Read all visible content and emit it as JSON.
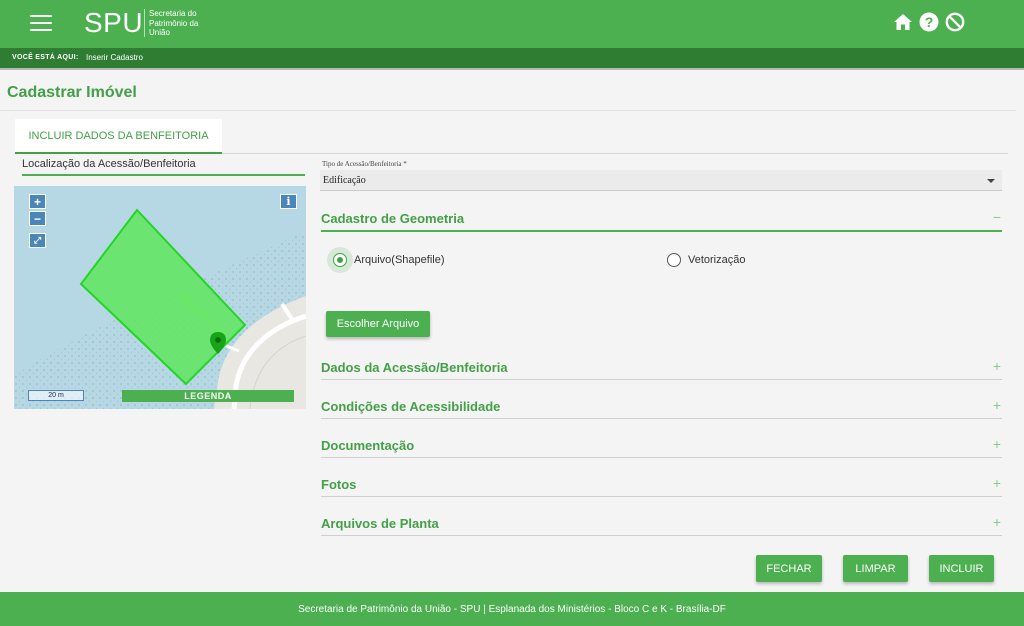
{
  "header": {
    "logo": "SPU",
    "logo_sub": "Secretaria do Patrimônio da União",
    "icons": [
      "home-icon",
      "help-icon",
      "block-icon"
    ]
  },
  "breadcrumb": {
    "label": "VOCÊ ESTÁ AQUI:",
    "item": "Inserir Cadastro"
  },
  "page": {
    "title": "Cadastrar Imóvel",
    "tab": "INCLUIR DADOS DA BENFEITORIA"
  },
  "map": {
    "label": "Localização da Acessão/Benfeitoria",
    "zoom_in": "+",
    "zoom_out": "−",
    "info": "i",
    "scale": "20 m",
    "legend": "LEGENDA"
  },
  "form": {
    "tipo_label": "Tipo de Acessão/Benfeitoria *",
    "tipo_value": "Edificação",
    "geometria": {
      "title": "Cadastro de Geometria",
      "sign": "−",
      "option_shapefile": "Arquivo(Shapefile)",
      "option_vetorizacao": "Vetorização",
      "selected": "Arquivo(Shapefile)",
      "choose_file": "Escolher Arquivo"
    },
    "sections": [
      {
        "title": "Dados da Acessão/Benfeitoria",
        "sign": "+"
      },
      {
        "title": "Condições de Acessibilidade",
        "sign": "+"
      },
      {
        "title": "Documentação",
        "sign": "+"
      },
      {
        "title": "Fotos",
        "sign": "+"
      },
      {
        "title": "Arquivos de Planta",
        "sign": "+"
      }
    ]
  },
  "actions": {
    "fechar": "FECHAR",
    "limpar": "LIMPAR",
    "incluir": "INCLUIR"
  },
  "footer": {
    "text": "Secretaria de Patrimônio da União - SPU | Esplanada dos Ministérios - Bloco C e K - Brasília-DF"
  },
  "colors": {
    "primary": "#4caf50",
    "primary_dark": "#2e7d32",
    "accent_text": "#43a047"
  }
}
